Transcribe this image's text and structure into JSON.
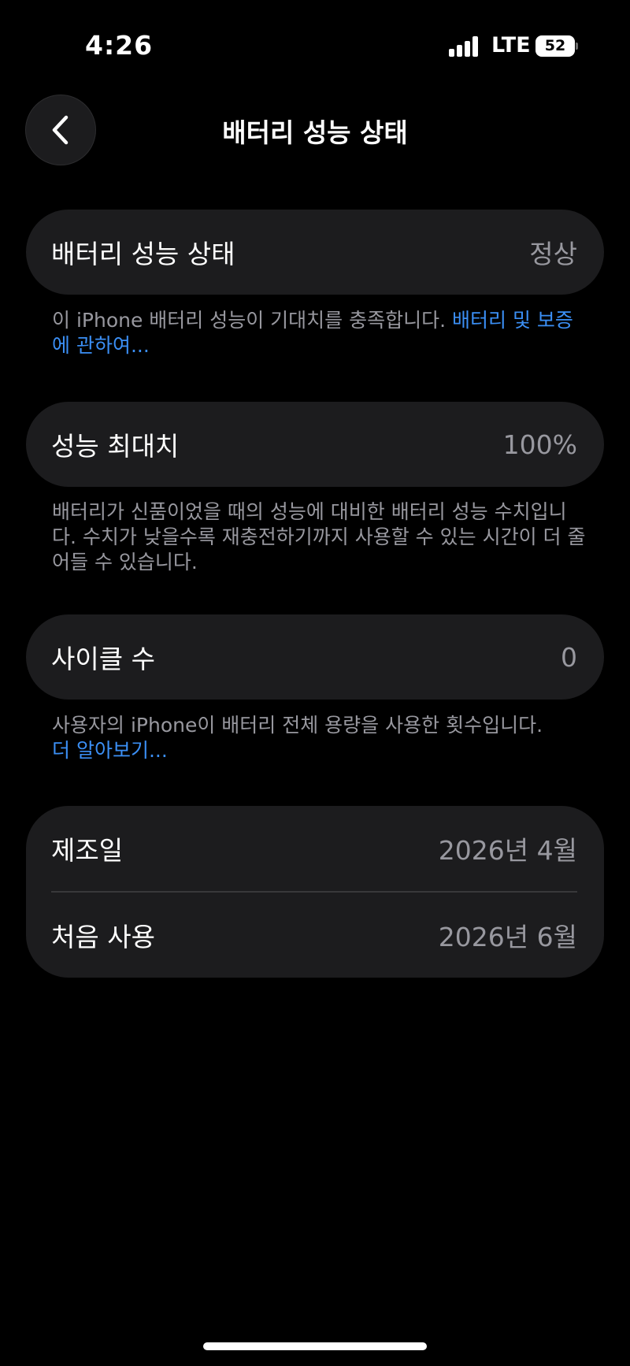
{
  "status_bar": {
    "time": "4:26",
    "network": "LTE",
    "battery_level": "52"
  },
  "nav": {
    "title": "배터리 성능 상태",
    "back_icon": "chevron-left-icon"
  },
  "health": {
    "label": "배터리 성능 상태",
    "value": "정상",
    "footnote_text": "이 iPhone 배터리 성능이 기대치를 충족합니다. ",
    "footnote_link": "배터리 및 보증에 관하여..."
  },
  "max_capacity": {
    "label": "성능 최대치",
    "value": "100%",
    "footnote_text": "배터리가 신품이었을 때의 성능에 대비한 배터리 성능 수치입니다. 수치가 낮을수록 재충전하기까지 사용할 수 있는 시간이 더 줄어들 수 있습니다."
  },
  "cycle_count": {
    "label": "사이클 수",
    "value": "0",
    "footnote_text": "사용자의 iPhone이 배터리 전체 용량을 사용한 횟수입니다.",
    "footnote_link": "더 알아보기..."
  },
  "dates": {
    "manufacture_label": "제조일",
    "manufacture_value": "2026년 4월",
    "first_use_label": "처음 사용",
    "first_use_value": "2026년 6월"
  },
  "colors": {
    "background": "#000000",
    "card": "#1c1c1e",
    "secondary_text": "#98989f",
    "link": "#3b8ff5"
  }
}
